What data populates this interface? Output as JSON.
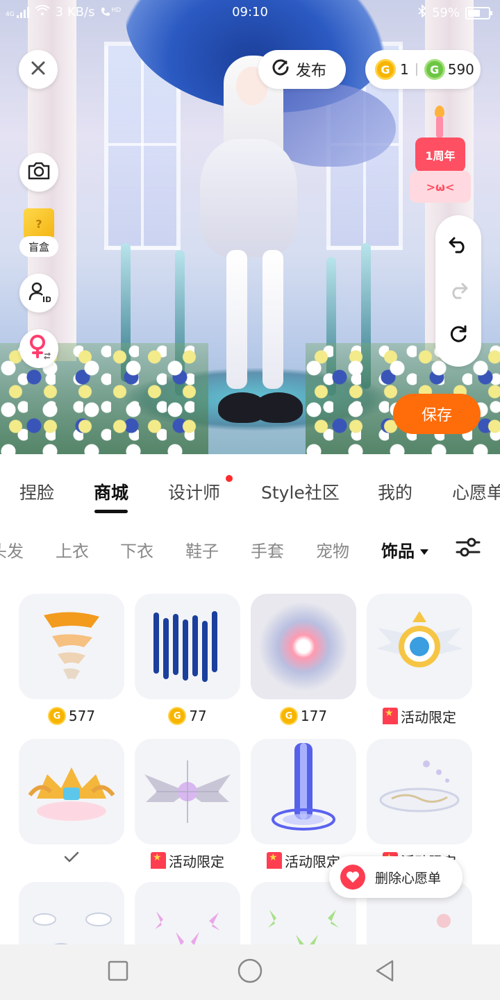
{
  "status_bar": {
    "network": "4G",
    "speed": "3 KB/s",
    "call_badge": "HD",
    "time": "09:10",
    "battery": "59%",
    "battery_level": 0.59
  },
  "scene": {
    "close_icon": "close-icon",
    "publish_label": "发布",
    "currency": {
      "gold_amount": "1",
      "green_amount": "590",
      "coin_glyph": "G"
    },
    "camera_icon": "camera-icon",
    "blind_box": {
      "glyph": "?",
      "label": "盲盒"
    },
    "id_icon": "user-id-icon",
    "gender_icon": "female-swap-icon",
    "anniversary_badge": {
      "top": "1周年",
      "face": ">ω<"
    },
    "undo_icon": "undo-icon",
    "redo_icon": "redo-icon",
    "reset_icon": "reset-icon",
    "save_label": "保存"
  },
  "main_tabs": [
    {
      "label": "捏脸"
    },
    {
      "label": "商城"
    },
    {
      "label": "设计师"
    },
    {
      "label": "Style社区"
    },
    {
      "label": "我的"
    },
    {
      "label": "心愿单"
    }
  ],
  "main_tabs_active": "商城",
  "sub_tabs": [
    {
      "label": "头发"
    },
    {
      "label": "上衣"
    },
    {
      "label": "下衣"
    },
    {
      "label": "鞋子"
    },
    {
      "label": "手套"
    },
    {
      "label": "宠物"
    },
    {
      "label": "饰品"
    }
  ],
  "sub_tabs_active": "饰品",
  "items": [
    {
      "price": "577",
      "tag": ""
    },
    {
      "price": "77",
      "tag": ""
    },
    {
      "price": "177",
      "tag": ""
    },
    {
      "price": "",
      "tag": "活动限定"
    },
    {
      "price": "",
      "tag": "",
      "owned": true
    },
    {
      "price": "",
      "tag": "活动限定"
    },
    {
      "price": "",
      "tag": "活动限定"
    },
    {
      "price": "",
      "tag": "活动限定"
    }
  ],
  "wishlist_toast": {
    "label": "删除心愿单"
  },
  "colors": {
    "accent_orange": "#ff6c0a",
    "coin_gold": "#f7b500",
    "coin_green": "#6cc644",
    "badge_red": "#ff3d50",
    "red_dot": "#ff2a2a"
  }
}
